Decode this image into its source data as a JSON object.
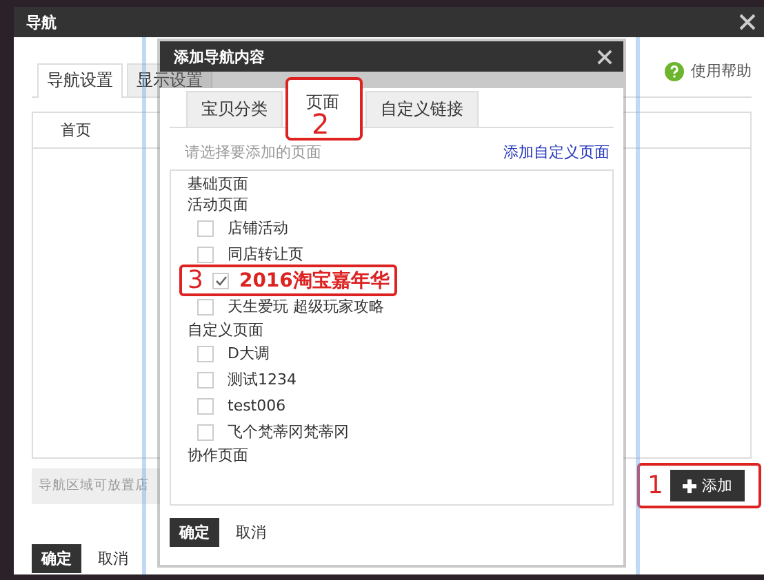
{
  "window": {
    "title": "导航"
  },
  "tabs": [
    {
      "label": "导航设置",
      "selected": true
    },
    {
      "label": "显示设置",
      "selected": false
    }
  ],
  "help": "使用帮助",
  "table": {
    "rows": [
      "首页"
    ]
  },
  "hint": "导航区域可放置店",
  "add_button": "添加",
  "footer": {
    "ok": "确定",
    "cancel": "取消"
  },
  "dialog": {
    "title": "添加导航内容",
    "tabs": [
      {
        "label": "宝贝分类",
        "selected": false
      },
      {
        "label": "页面",
        "selected": true
      },
      {
        "label": "自定义链接",
        "selected": false
      }
    ],
    "prompt": "请选择要添加的页面",
    "link": "添加自定义页面",
    "groups": [
      {
        "label": "基础页面"
      },
      {
        "label": "活动页面",
        "children": [
          {
            "label": "店铺活动",
            "checked": false
          },
          {
            "label": "同店转让页",
            "checked": false
          },
          {
            "label": "2016淘宝嘉年华",
            "checked": true
          },
          {
            "label": "天生爱玩 超级玩家攻略",
            "checked": false
          }
        ]
      },
      {
        "label": "自定义页面",
        "children": [
          {
            "label": "D大调",
            "checked": false
          },
          {
            "label": "测试1234",
            "checked": false
          },
          {
            "label": "test006",
            "checked": false
          },
          {
            "label": "飞个梵蒂冈梵蒂冈",
            "checked": false
          }
        ]
      },
      {
        "label": "协作页面"
      }
    ],
    "footer": {
      "ok": "确定",
      "cancel": "取消"
    }
  },
  "annotations": [
    "1",
    "2",
    "3"
  ]
}
